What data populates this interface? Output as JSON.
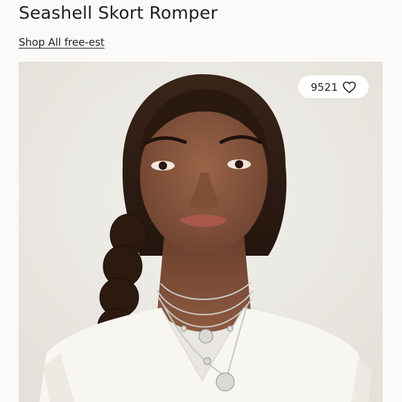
{
  "product": {
    "title": "Seashell Skort Romper",
    "shop_link_label": "Shop All free-est"
  },
  "hero": {
    "alt": "Model wearing layered silver necklaces and a white top",
    "like_count": "9521",
    "like_icon": "heart-outline-icon"
  },
  "colors": {
    "background": "#fbfaf8",
    "photo_background": "#eceae4",
    "text": "#1e1e1e"
  }
}
